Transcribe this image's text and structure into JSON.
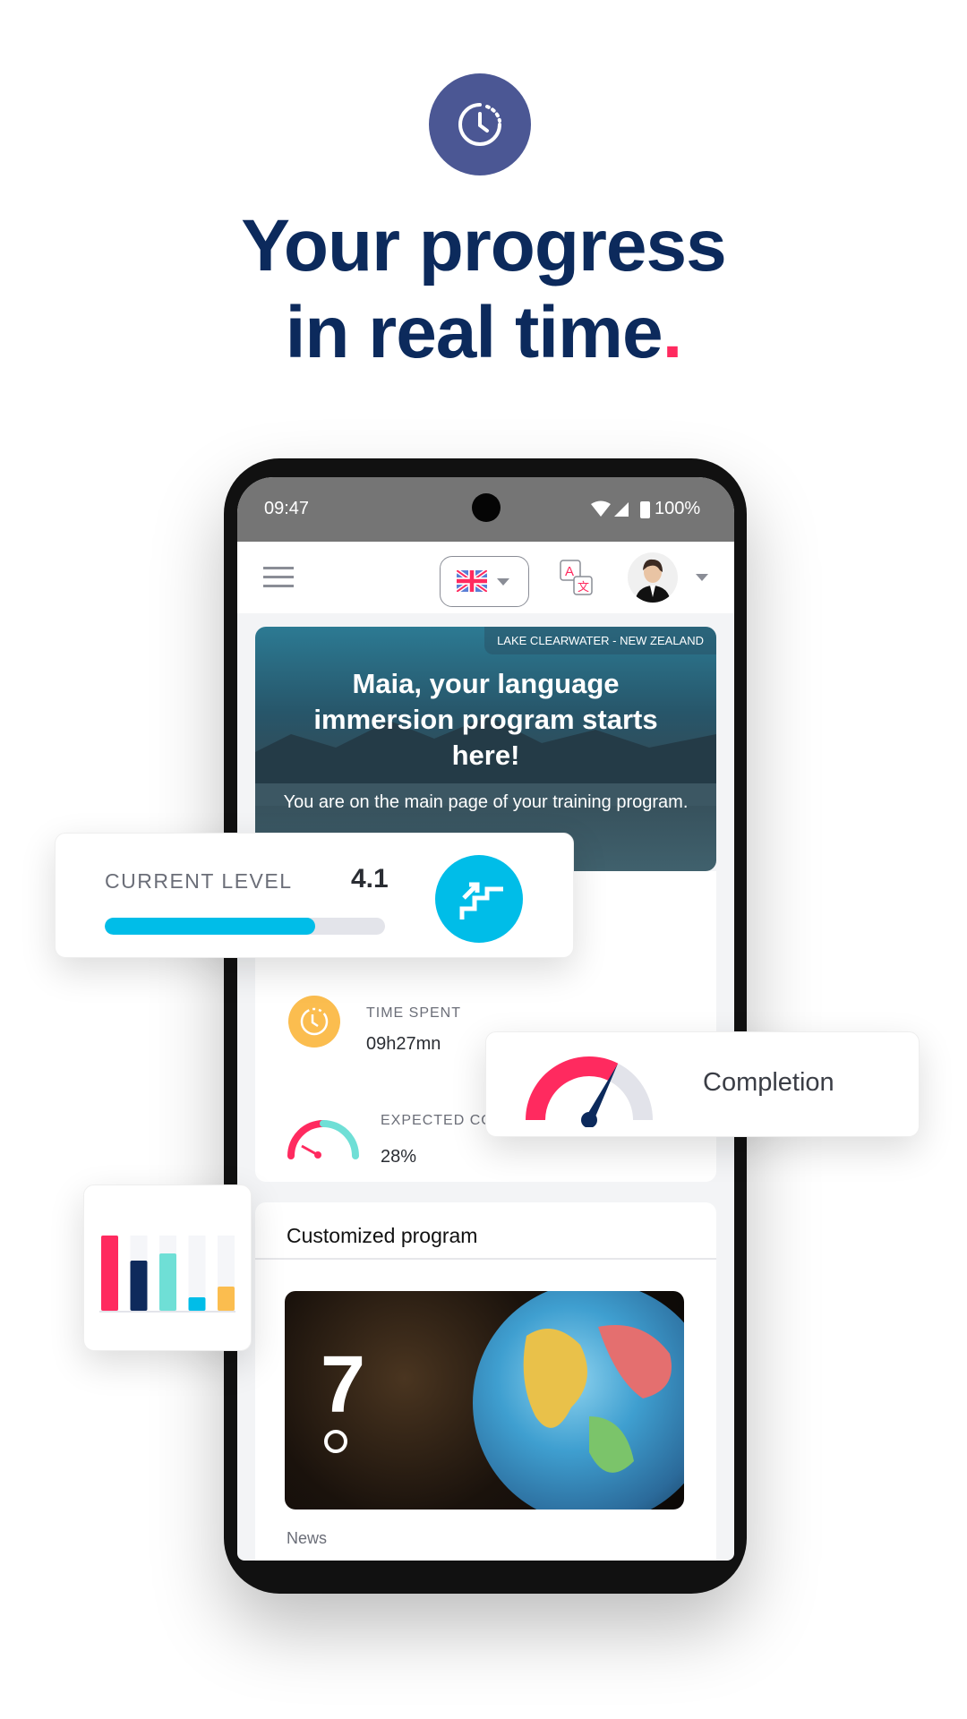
{
  "headline": {
    "line1": "Your progress",
    "line2": "in real time",
    "dot": "."
  },
  "icons": {
    "top": "clock-progress-icon"
  },
  "status_bar": {
    "time": "09:47",
    "battery": "100%"
  },
  "app_bar": {
    "language": "English (UK)",
    "menu": "hamburger-menu-icon",
    "translate": "translate-icon",
    "avatar": "user-avatar"
  },
  "hero": {
    "location": "LAKE CLEARWATER - NEW ZEALAND",
    "title": "Maia, your language immersion program starts here!",
    "subtitle": "You are on the main page of your training program."
  },
  "level_card": {
    "label": "CURRENT LEVEL",
    "value": "4.1",
    "progress_percent": 75
  },
  "stats": {
    "time_label": "TIME SPENT",
    "time_value": "09h27mn",
    "expected_label": "EXPECTED CO",
    "expected_value": "28%"
  },
  "completion_card": {
    "label": "Completion",
    "gauge_percent": 65
  },
  "mini_chart": {
    "values": [
      84,
      56,
      64,
      15,
      27
    ],
    "colors": [
      "#ff2a5f",
      "#0e2a5c",
      "#6fdfd6",
      "#00bde8",
      "#fbbd4f"
    ]
  },
  "program": {
    "title": "Customized program",
    "logo": "7"
  },
  "news": {
    "label": "News"
  },
  "colors": {
    "navy": "#0c2a5c",
    "pink": "#ff2a5f",
    "cyan": "#00bde8",
    "yellow": "#fbbd4f",
    "teal": "#6fdfd6",
    "indigo": "#4b5794"
  }
}
